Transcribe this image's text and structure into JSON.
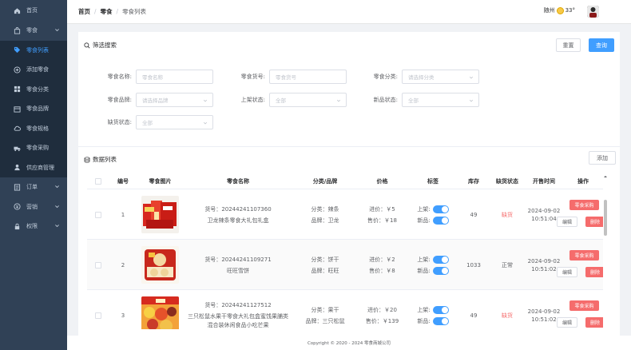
{
  "sidebar": {
    "items": [
      {
        "label": "首页",
        "icon": "home-icon"
      },
      {
        "label": "零食",
        "icon": "bag-icon",
        "expandable": true
      },
      {
        "label": "零食列表",
        "icon": "tag-icon",
        "active": true
      },
      {
        "label": "添加零食",
        "icon": "plus-circle-icon"
      },
      {
        "label": "零食分类",
        "icon": "grid-icon"
      },
      {
        "label": "零食品牌",
        "icon": "box-icon"
      },
      {
        "label": "零食规格",
        "icon": "cloud-icon"
      },
      {
        "label": "零食采购",
        "icon": "truck-icon"
      },
      {
        "label": "供应商管理",
        "icon": "user-icon"
      },
      {
        "label": "订单",
        "icon": "list-icon",
        "expandable": true
      },
      {
        "label": "营销",
        "icon": "coin-icon",
        "expandable": true
      },
      {
        "label": "权限",
        "icon": "lock-icon",
        "expandable": true
      }
    ]
  },
  "header": {
    "breadcrumb": [
      "首页",
      "零食",
      "零食列表"
    ],
    "city": "随州",
    "temp": "33°"
  },
  "filter": {
    "title": "筛选搜索",
    "reset": "重置",
    "query": "查询",
    "fields": [
      {
        "label": "零食名称:",
        "placeholder": "零食名称"
      },
      {
        "label": "零食货号:",
        "placeholder": "零食货号"
      },
      {
        "label": "零食分类:",
        "placeholder": "请选择分类"
      },
      {
        "label": "零食品牌:",
        "placeholder": "请选择品牌"
      },
      {
        "label": "上架状态:",
        "placeholder": "全部"
      },
      {
        "label": "新品状态:",
        "placeholder": "全部"
      },
      {
        "label": "缺货状态:",
        "placeholder": "全部"
      }
    ]
  },
  "list": {
    "title": "数据列表",
    "add": "添加",
    "columns": [
      "编号",
      "零食图片",
      "零食名称",
      "分类/品牌",
      "价格",
      "标签",
      "库存",
      "缺货状态",
      "开售时间",
      "操作"
    ],
    "labels": {
      "sku_prefix": "货号：",
      "category_prefix": "分类：",
      "brand_prefix": "品牌：",
      "cost_prefix": "进价：",
      "price_prefix": "售价：",
      "on_shelf": "上架:",
      "new": "新品:",
      "purchase": "零食采购",
      "edit": "编辑",
      "delete": "删除"
    },
    "rows": [
      {
        "id": "1",
        "sku": "20244241107360",
        "name": "卫龙辣条零食大礼包礼盒",
        "category": "辣条",
        "brand": "卫龙",
        "cost": "￥5",
        "price": "￥18",
        "stock": "49",
        "status": "缺货",
        "status_color": "#f56c6c",
        "date": "2024-09-02",
        "time": "10:51:04",
        "img": "spicy"
      },
      {
        "id": "2",
        "sku": "20244241109271",
        "name": "旺旺雪饼",
        "category": "饼干",
        "brand": "旺旺",
        "cost": "￥2",
        "price": "￥8",
        "stock": "1033",
        "status": "正常",
        "status_color": "#606266",
        "date": "2024-09-02",
        "time": "10:51:02",
        "img": "cracker"
      },
      {
        "id": "3",
        "sku": "20244241127512",
        "name": "三只松鼠水果干零食大礼包盒蜜饯果脯类混合装休闲食品小吃芒果",
        "category": "果干",
        "brand": "三只松鼠",
        "cost": "￥20",
        "price": "￥139",
        "stock": "49",
        "status": "缺货",
        "status_color": "#f56c6c",
        "date": "2024-09-02",
        "time": "10:51:02",
        "img": "fruit"
      }
    ]
  },
  "footer": "Copyright © 2020 - 2024  零食商城公司",
  "colors": {
    "sidebar": "#304156",
    "accent": "#409eff",
    "danger": "#f56c6c"
  }
}
